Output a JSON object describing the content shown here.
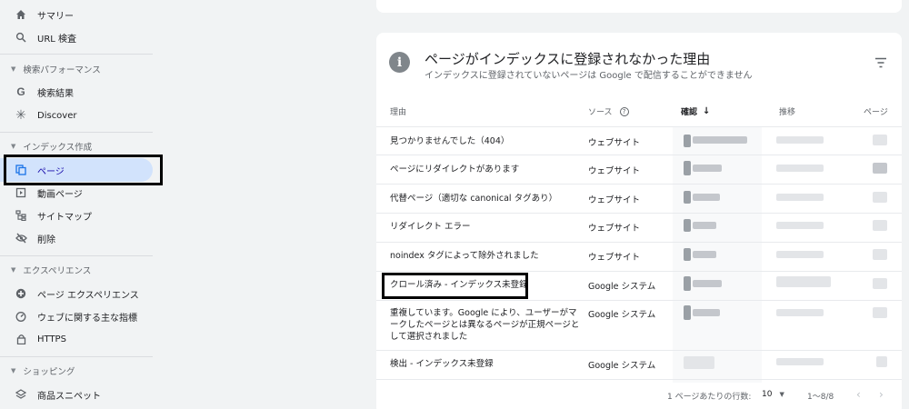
{
  "sidebar": {
    "items": [
      {
        "label": "サマリー",
        "icon": "home-icon"
      },
      {
        "label": "URL 検査",
        "icon": "search-icon"
      },
      {
        "label": "検索結果",
        "icon": "google-g-icon"
      },
      {
        "label": "Discover",
        "icon": "asterisk-icon"
      },
      {
        "label": "ページ",
        "icon": "pages-icon"
      },
      {
        "label": "動画ページ",
        "icon": "video-page-icon"
      },
      {
        "label": "サイトマップ",
        "icon": "sitemap-icon"
      },
      {
        "label": "削除",
        "icon": "eye-off-icon"
      },
      {
        "label": "ページ エクスペリエンス",
        "icon": "plus-circle-icon"
      },
      {
        "label": "ウェブに関する主な指標",
        "icon": "speedometer-icon"
      },
      {
        "label": "HTTPS",
        "icon": "lock-icon"
      },
      {
        "label": "商品スニペット",
        "icon": "layers-icon"
      }
    ],
    "sections": [
      {
        "label": "検索パフォーマンス"
      },
      {
        "label": "インデックス作成"
      },
      {
        "label": "エクスペリエンス"
      },
      {
        "label": "ショッピング"
      }
    ]
  },
  "card": {
    "title": "ページがインデックスに登録されなかった理由",
    "subtitle": "インデックスに登録されていないページは Google で配信することができません",
    "columns": {
      "reason": "理由",
      "source": "ソース",
      "confirm": "確認",
      "trend": "推移",
      "pages": "ページ"
    },
    "rows": [
      {
        "reason": "見つかりませんでした（404）",
        "source": "ウェブサイト"
      },
      {
        "reason": "ページにリダイレクトがあります",
        "source": "ウェブサイト"
      },
      {
        "reason": "代替ページ（適切な canonical タグあり）",
        "source": "ウェブサイト"
      },
      {
        "reason": "リダイレクト エラー",
        "source": "ウェブサイト"
      },
      {
        "reason": "noindex タグによって除外されました",
        "source": "ウェブサイト"
      },
      {
        "reason": "クロール済み - インデックス未登録",
        "source": "Google システム"
      },
      {
        "reason": "重複しています。Google により、ユーザーがマークしたページとは異なるページが正規ページとして選択されました",
        "source": "Google システム"
      },
      {
        "reason": "検出 - インデックス未登録",
        "source": "Google システム"
      }
    ],
    "footer": {
      "rows_per_page_label": "1 ページあたりの行数:",
      "rows_per_page_value": "10",
      "range": "1〜8/8"
    }
  },
  "colors": {
    "selected_bg": "#d2e3fc",
    "accent": "#1a73e8"
  }
}
